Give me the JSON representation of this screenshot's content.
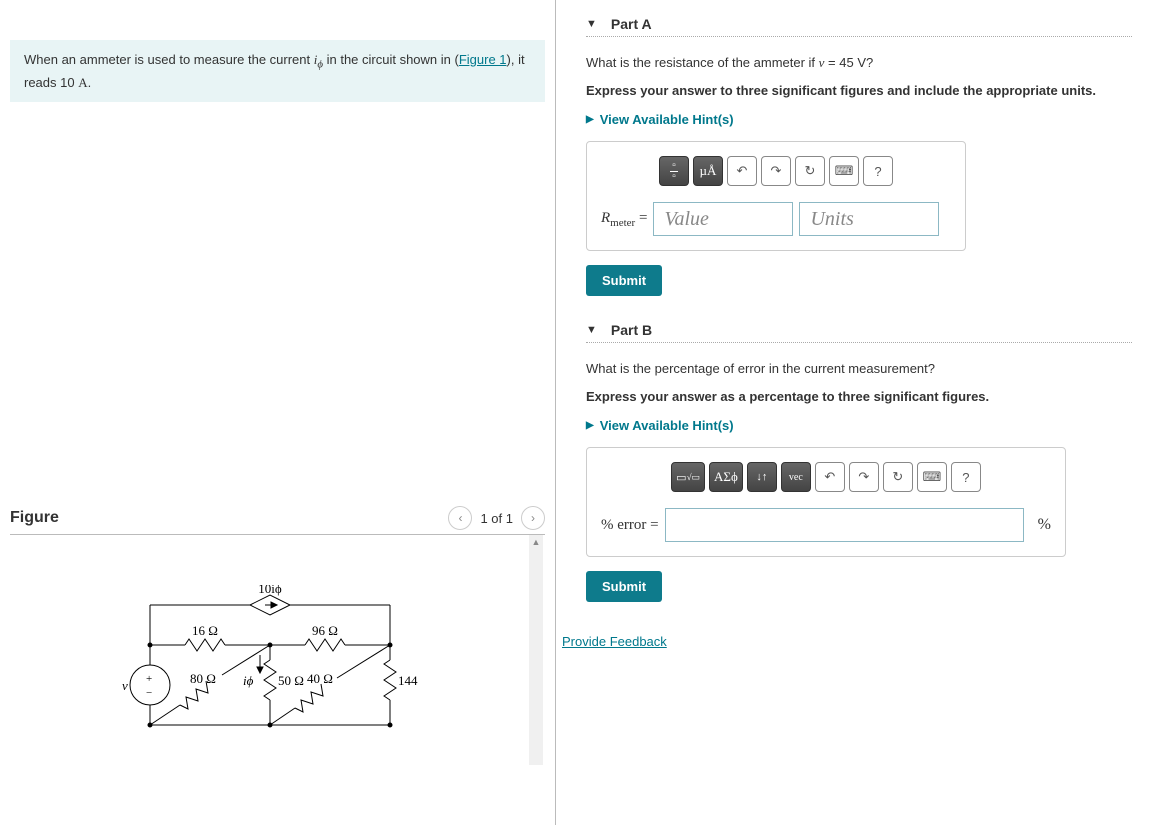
{
  "problem": {
    "text_pre": "When an ammeter is used to measure the current ",
    "var_i": "i",
    "var_sub": "ϕ",
    "text_mid": " in the circuit shown in (",
    "figure_link": "Figure 1",
    "text_post": "), it reads 10 ",
    "unit": "A",
    "text_end": "."
  },
  "figure": {
    "title": "Figure",
    "nav_label": "1 of 1",
    "labels": {
      "top": "10iϕ",
      "r1": "16 Ω",
      "r2": "96 Ω",
      "r3": "80 Ω",
      "r4": "50 Ω",
      "r5": "40 Ω",
      "r6": "144 Ω",
      "iphi": "iϕ",
      "v": "v"
    }
  },
  "partA": {
    "title": "Part A",
    "question_pre": "What is the resistance of the ammeter if ",
    "var": "v",
    "question_post": " = 45 V?",
    "instruction": "Express your answer to three significant figures and include the appropriate units.",
    "hints": "View Available Hint(s)",
    "toolbar": {
      "frac": "▭/▭",
      "units": "µÅ",
      "undo": "↶",
      "redo": "↷",
      "reset": "↻",
      "keyboard": "⌨",
      "help": "?"
    },
    "answer_label": "R",
    "answer_sub": "meter",
    "eq": " = ",
    "value_placeholder": "Value",
    "units_placeholder": "Units",
    "submit": "Submit"
  },
  "partB": {
    "title": "Part B",
    "question": "What is the percentage of error in the current measurement?",
    "instruction": "Express your answer as a percentage to three significant figures.",
    "hints": "View Available Hint(s)",
    "toolbar": {
      "tmpl": "▭√▭",
      "greek": "ΑΣϕ",
      "arrows": "↓↑",
      "vec": "vec",
      "undo": "↶",
      "redo": "↷",
      "reset": "↻",
      "keyboard": "⌨",
      "help": "?"
    },
    "answer_label": "% error = ",
    "suffix": "%",
    "submit": "Submit"
  },
  "feedback": "Provide Feedback"
}
